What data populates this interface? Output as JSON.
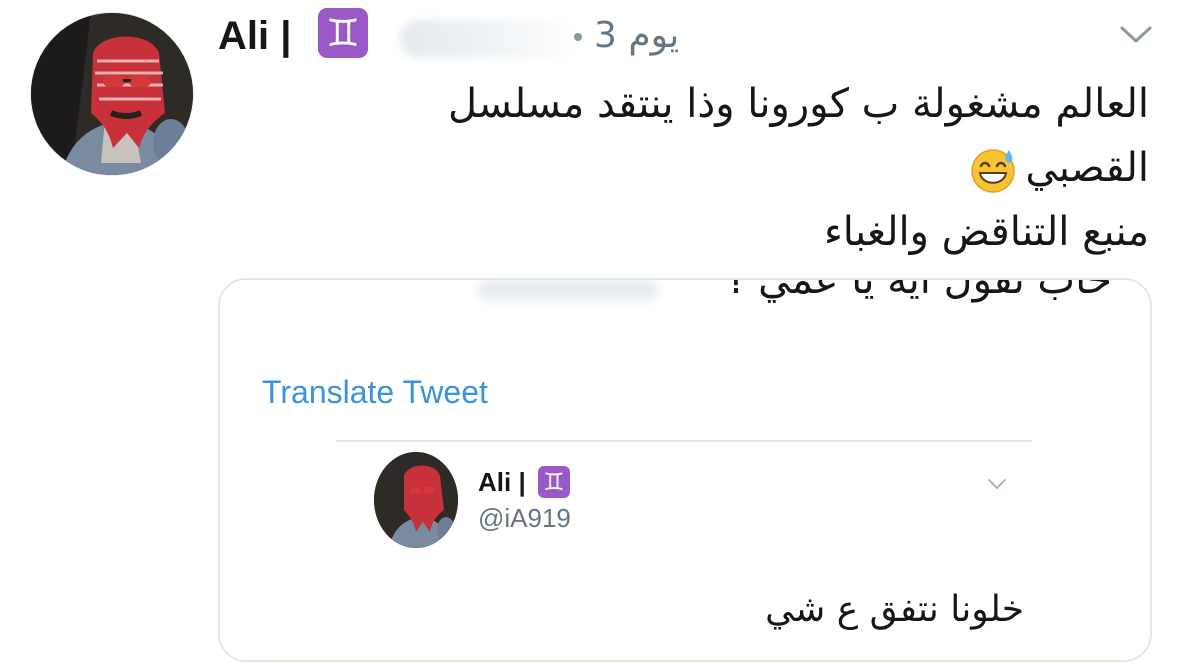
{
  "tweet": {
    "author_name": "Ali |",
    "author_sign": "♊",
    "time": "3 يوم",
    "text_lines": [
      "العالم مشغولة ب كورونا وذا ينتقد مسلسل",
      "القصبي",
      "منبع التناقض والغباء"
    ],
    "emoji": "sweat-smile-emoji"
  },
  "quoted": {
    "clipped_line": "حاب تقول ايه يا عمي ؟",
    "translate_label": "Translate Tweet",
    "inner_author_name": "Ali |",
    "inner_author_sign": "♊",
    "inner_handle": "@iA919",
    "inner_text": "خلونا نتفق ع شي"
  },
  "colors": {
    "link": "#3b94d9",
    "muted": "#657786",
    "badge": "#9b59c7",
    "border": "#e1e8ed"
  }
}
